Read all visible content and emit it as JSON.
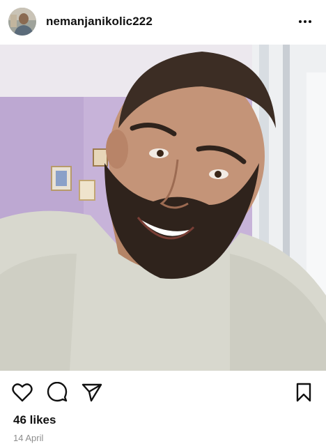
{
  "header": {
    "username": "nemanjanikolic222",
    "avatar_icon": "profile-avatar",
    "more_icon": "more-horizontal-icon"
  },
  "photo": {
    "subject": "selfie"
  },
  "actions": {
    "like_icon": "heart-icon",
    "comment_icon": "comment-icon",
    "share_icon": "send-icon",
    "save_icon": "bookmark-icon"
  },
  "meta": {
    "likes": "46 likes",
    "date": "14 April"
  },
  "colors": {
    "text": "#111111",
    "muted": "#8e8e8e",
    "wall": "#c8b7d8",
    "sweater": "#d9d9cf"
  }
}
